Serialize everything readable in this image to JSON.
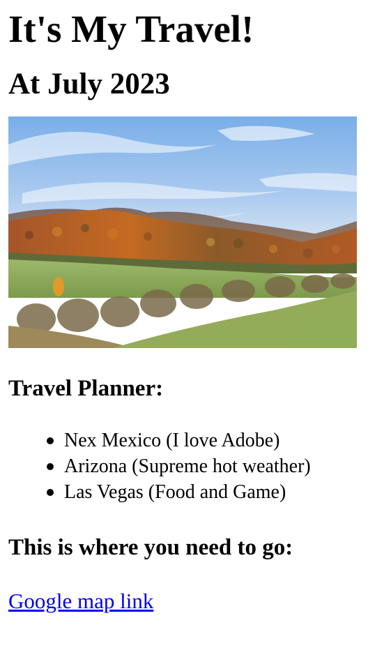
{
  "title": "It's My Travel!",
  "subtitle": "At July 2023",
  "hero_image": {
    "alt": "",
    "colors": {
      "sky_top": "#7fb2ec",
      "sky_bottom": "#c9dcf2",
      "foliage": "#b35a1f",
      "field": "#8fae5a"
    }
  },
  "planner": {
    "heading": "Travel Planner:",
    "items": [
      "Nex Mexico (I love Adobe)",
      "Arizona (Supreme hot weather)",
      "Las Vegas (Food and Game)"
    ]
  },
  "directions": {
    "heading": "This is where you need to go:",
    "link_label": "Google map link",
    "link_color": "#0000ee"
  }
}
